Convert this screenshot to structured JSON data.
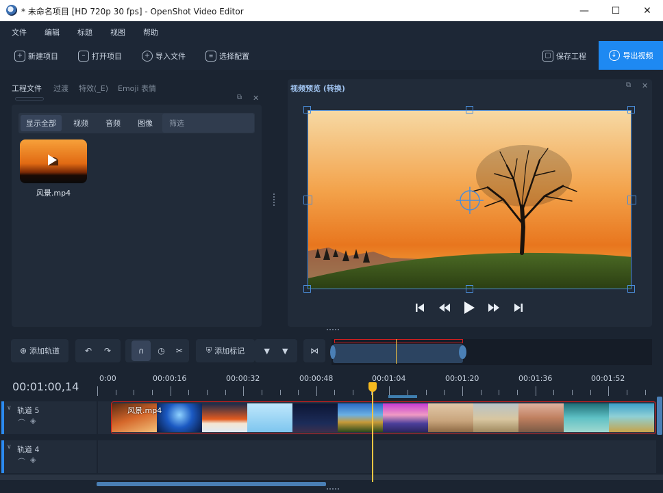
{
  "window": {
    "title": "* 未命名项目 [HD 720p 30 fps] - OpenShot Video Editor"
  },
  "menu": [
    "文件",
    "编辑",
    "标题",
    "视图",
    "帮助"
  ],
  "toolbar": {
    "new_project": "新建项目",
    "open_project": "打开项目",
    "import_files": "导入文件",
    "choose_profile": "选择配置",
    "save_project": "保存工程",
    "export_video": "导出视频"
  },
  "project_panel": {
    "tabs": [
      "工程文件",
      "过渡",
      "特效(_E)",
      "Emoji 表情"
    ],
    "filters": [
      "显示全部",
      "视频",
      "音频",
      "图像"
    ],
    "filter_placeholder": "筛选",
    "files": [
      {
        "name": "风景.mp4"
      }
    ]
  },
  "preview_panel": {
    "title": "视频预览 (转换)"
  },
  "timeline": {
    "add_track": "添加轨道",
    "add_marker": "添加标记",
    "timecode": "00:01:00,14",
    "ruler_labels": [
      "0:00",
      "00:00:16",
      "00:00:32",
      "00:00:48",
      "00:01:04",
      "00:01:20",
      "00:01:36",
      "00:01:52"
    ],
    "tracks": [
      {
        "name": "轨道 5",
        "clip": "风景.mp4"
      },
      {
        "name": "轨道 4"
      }
    ]
  },
  "colors": {
    "accent": "#1e89f2",
    "playhead": "#f5c542",
    "clip_border": "#d01f1f",
    "selection": "#4a8cd8"
  }
}
